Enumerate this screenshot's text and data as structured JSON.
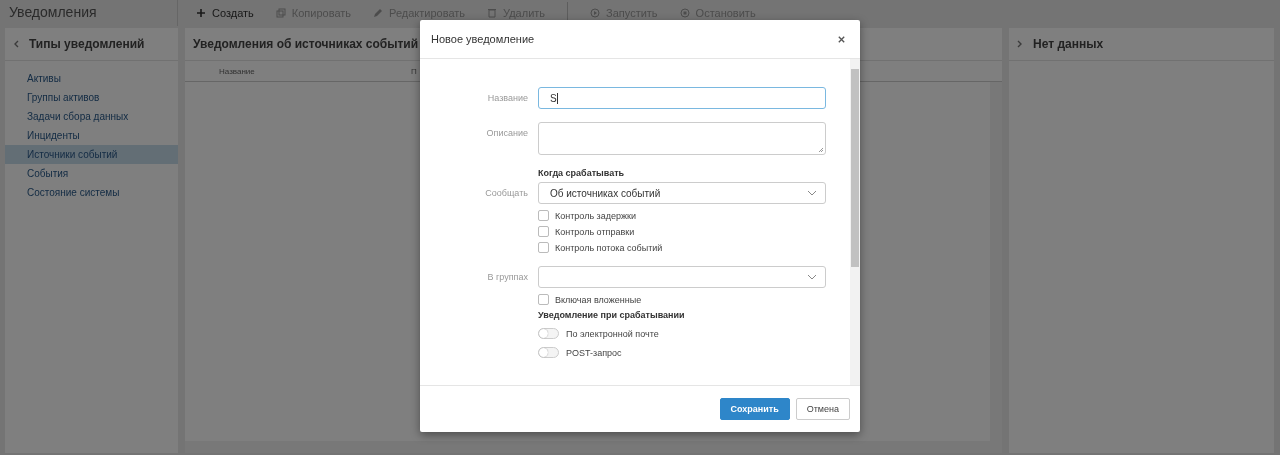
{
  "app_title": "Уведомления",
  "toolbar": [
    {
      "label": "Создать",
      "kind": "plus",
      "disabled": false
    },
    {
      "label": "Копировать",
      "kind": "copy",
      "disabled": true
    },
    {
      "label": "Редактировать",
      "kind": "pencil",
      "disabled": true
    },
    {
      "label": "Удалить",
      "kind": "trash",
      "disabled": true
    },
    {
      "label": "Запустить",
      "kind": "play",
      "disabled": true,
      "separator_before": true
    },
    {
      "label": "Остановить",
      "kind": "stop",
      "disabled": true
    }
  ],
  "sidebar": {
    "title": "Типы уведомлений",
    "items": [
      {
        "label": "Активы",
        "selected": false
      },
      {
        "label": "Группы активов",
        "selected": false
      },
      {
        "label": "Задачи сбора данных",
        "selected": false
      },
      {
        "label": "Инциденты",
        "selected": false
      },
      {
        "label": "Источники событий",
        "selected": true
      },
      {
        "label": "События",
        "selected": false
      },
      {
        "label": "Состояние системы",
        "selected": false
      }
    ]
  },
  "list_panel": {
    "title": "Уведомления об источниках событий",
    "columns": [
      "Название",
      "П"
    ]
  },
  "detail_panel": {
    "title": "Нет данных"
  },
  "dialog": {
    "title": "Новое уведомление",
    "fields": [
      {
        "kind": "text",
        "label": "Название",
        "value": "S",
        "focused": true
      },
      {
        "kind": "textarea",
        "label": "Описание"
      },
      {
        "kind": "heading",
        "text": "Когда срабатывать"
      },
      {
        "kind": "select",
        "label": "Сообщать",
        "value": "Об источниках событий"
      },
      {
        "kind": "checkbox",
        "text": "Контроль задержки",
        "checked": false
      },
      {
        "kind": "checkbox",
        "text": "Контроль отправки",
        "checked": false
      },
      {
        "kind": "checkbox",
        "text": "Контроль потока событий",
        "checked": false
      },
      {
        "kind": "select",
        "label": "В группах"
      },
      {
        "kind": "checkbox",
        "text": "Включая вложенные",
        "checked": false
      },
      {
        "kind": "heading",
        "text": "Уведомление при срабатывании"
      },
      {
        "kind": "toggle",
        "text": "По электронной почте",
        "on": false
      },
      {
        "kind": "toggle",
        "text": "POST-запрос",
        "on": false
      }
    ],
    "buttons": [
      {
        "label": "Сохранить",
        "primary": true
      },
      {
        "label": "Отмена",
        "primary": false
      }
    ]
  }
}
